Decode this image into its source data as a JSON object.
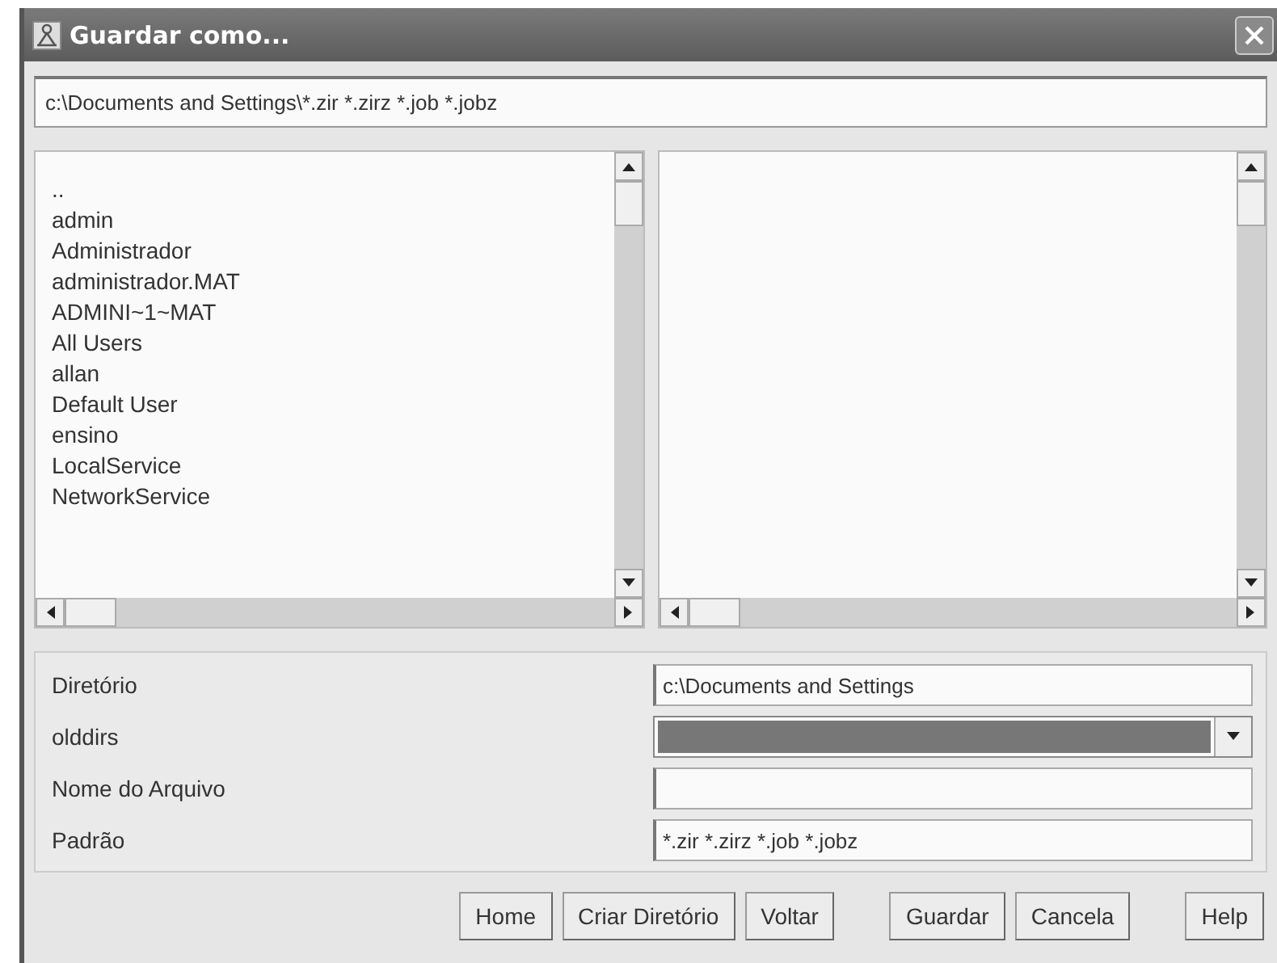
{
  "window": {
    "title": "Guardar como..."
  },
  "path_field": {
    "value": "c:\\Documents and Settings\\*.zir *.zirz *.job *.jobz"
  },
  "folders": [
    {
      "name": ".."
    },
    {
      "name": "admin"
    },
    {
      "name": "Administrador"
    },
    {
      "name": "administrador.MAT"
    },
    {
      "name": "ADMINI~1~MAT"
    },
    {
      "name": "All Users"
    },
    {
      "name": "allan"
    },
    {
      "name": "Default User"
    },
    {
      "name": "ensino"
    },
    {
      "name": "LocalService"
    },
    {
      "name": "NetworkService"
    }
  ],
  "form": [
    {
      "label": "Diretório",
      "kind": "text",
      "value": "c:\\Documents and Settings"
    },
    {
      "label": "olddirs",
      "kind": "dropdown"
    },
    {
      "label": "Nome do Arquivo",
      "kind": "text"
    },
    {
      "label": "Padrão",
      "kind": "text",
      "value": "*.zir *.zirz *.job *.jobz"
    }
  ],
  "buttons": [
    {
      "label": "Home"
    },
    {
      "label": "Criar Diretório"
    },
    {
      "label": "Voltar"
    },
    {
      "label": "Guardar"
    },
    {
      "label": "Cancela"
    },
    {
      "label": "Help"
    }
  ]
}
